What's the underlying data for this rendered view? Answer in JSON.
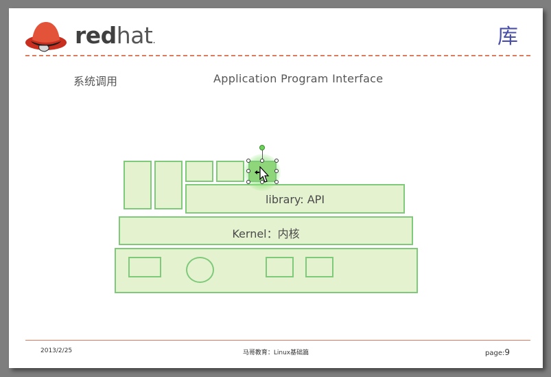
{
  "header": {
    "logo_bold": "red",
    "logo_light": "hat",
    "logo_mark": ".",
    "slide_title": "库"
  },
  "labels": {
    "syscall": "系统调用",
    "api": "Application Program Interface"
  },
  "diagram": {
    "library": "library: API",
    "kernel": "Kernel：内核"
  },
  "footer": {
    "date": "2013/2/25",
    "center": "马哥教育：Linux基础篇",
    "page_prefix": "page:",
    "page_number": "9"
  },
  "colors": {
    "accent_rule": "#e07a5a",
    "box_fill": "#e5f2d0",
    "box_stroke": "#7ec97a",
    "title": "#4a4fa8",
    "logo_hat": "#e2533a"
  },
  "icons": [
    "redhat-logo-icon",
    "move-cursor-icon"
  ]
}
